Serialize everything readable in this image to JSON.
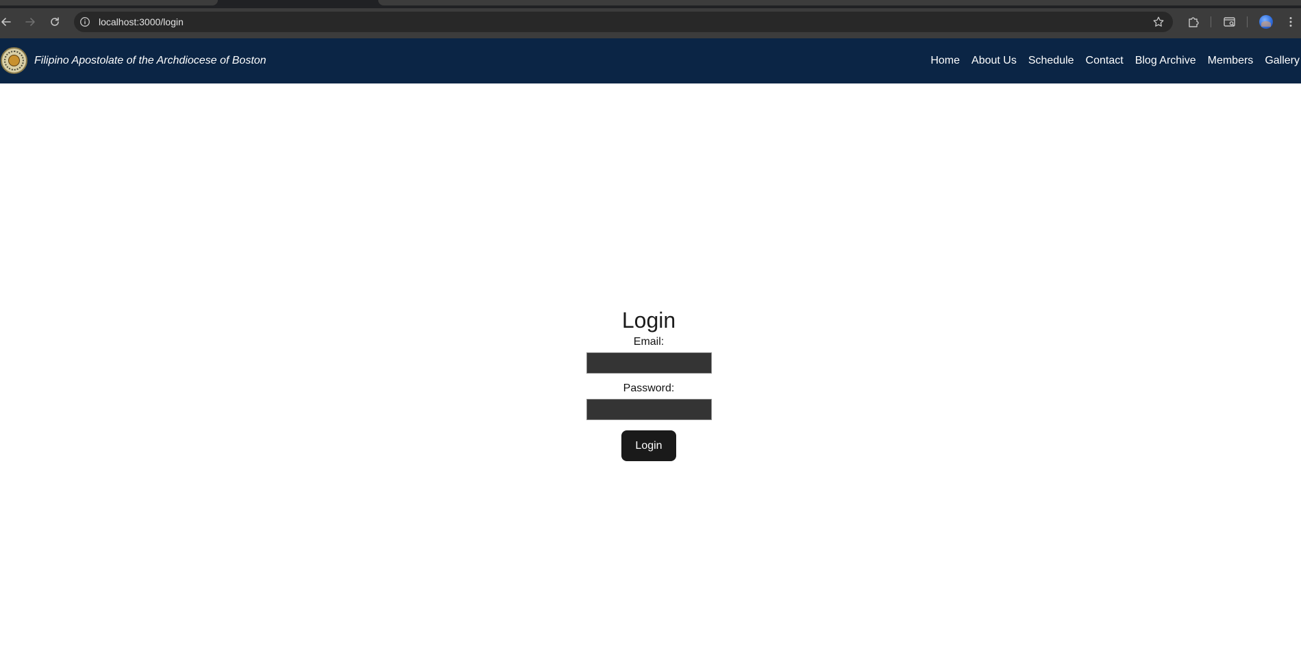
{
  "browser": {
    "url": "localhost:3000/login",
    "icons": {
      "back": "back-arrow-icon",
      "forward": "forward-arrow-icon",
      "reload": "reload-icon",
      "site_info": "info-icon",
      "bookmark": "star-icon",
      "extensions": "puzzle-icon",
      "tab_search": "tab-search-icon",
      "profile": "avatar",
      "menu": "kebab-menu-icon"
    }
  },
  "header": {
    "title": "Filipino Apostolate of the Archdiocese of Boston",
    "background_color": "#0b2545",
    "nav": [
      {
        "label": "Home"
      },
      {
        "label": "About Us"
      },
      {
        "label": "Schedule"
      },
      {
        "label": "Contact"
      },
      {
        "label": "Blog Archive"
      },
      {
        "label": "Members"
      },
      {
        "label": "Gallery"
      }
    ]
  },
  "login": {
    "title": "Login",
    "email_label": "Email:",
    "email_value": "",
    "password_label": "Password:",
    "password_value": "",
    "submit_label": "Login"
  }
}
